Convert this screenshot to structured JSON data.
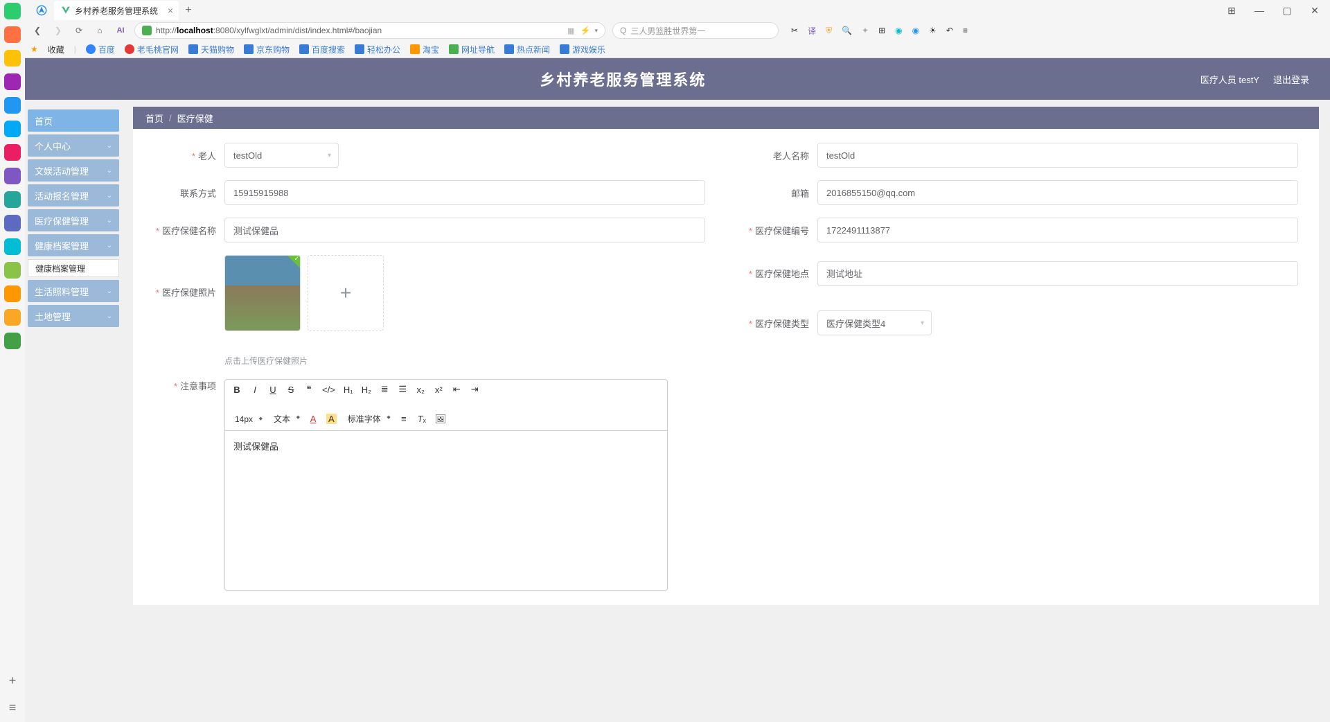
{
  "browser": {
    "tab_title": "乡村养老服务管理系统",
    "url_prefix": "http://",
    "url_host": "localhost",
    "url_rest": ":8080/xylfwglxt/admin/dist/index.html#/baojian",
    "search_placeholder": "三人男篮胜世界第一",
    "favorites_label": "收藏",
    "bookmarks": [
      {
        "label": "百度",
        "color": "#3385ff"
      },
      {
        "label": "老毛桃官网",
        "color": "#e53935"
      },
      {
        "label": "天猫购物",
        "color": "#3a7bd5"
      },
      {
        "label": "京东购物",
        "color": "#3a7bd5"
      },
      {
        "label": "百度搜索",
        "color": "#3a7bd5"
      },
      {
        "label": "轻松办公",
        "color": "#3a7bd5"
      },
      {
        "label": "淘宝",
        "color": "#ff9800"
      },
      {
        "label": "网址导航",
        "color": "#4caf50"
      },
      {
        "label": "热点新闻",
        "color": "#3a7bd5"
      },
      {
        "label": "游戏娱乐",
        "color": "#3a7bd5"
      }
    ]
  },
  "header": {
    "title": "乡村养老服务管理系统",
    "user_label": "医疗人员 testY",
    "logout": "退出登录"
  },
  "sidebar": {
    "items": [
      {
        "label": "首页",
        "type": "home"
      },
      {
        "label": "个人中心",
        "type": "exp"
      },
      {
        "label": "文娱活动管理",
        "type": "exp"
      },
      {
        "label": "活动报名管理",
        "type": "exp"
      },
      {
        "label": "医疗保健管理",
        "type": "exp"
      },
      {
        "label": "健康档案管理",
        "type": "exp"
      },
      {
        "label": "健康档案管理",
        "type": "sub"
      },
      {
        "label": "生活照料管理",
        "type": "exp"
      },
      {
        "label": "土地管理",
        "type": "exp"
      }
    ]
  },
  "breadcrumb": {
    "root": "首页",
    "current": "医疗保健"
  },
  "form": {
    "labels": {
      "elder": "老人",
      "elder_name": "老人名称",
      "contact": "联系方式",
      "email": "邮箱",
      "hc_name": "医疗保健名称",
      "hc_code": "医疗保健编号",
      "hc_photo": "医疗保健照片",
      "hc_place": "医疗保健地点",
      "hc_type": "医疗保健类型",
      "notice": "注意事项"
    },
    "values": {
      "elder": "testOld",
      "elder_name": "testOld",
      "contact": "15915915988",
      "email": "2016855150@qq.com",
      "hc_name": "测试保健品",
      "hc_code": "1722491113877",
      "hc_place": "测试地址",
      "hc_type": "医疗保健类型4"
    },
    "upload_hint": "点击上传医疗保健照片"
  },
  "editor": {
    "font_size": "14px",
    "paragraph": "文本",
    "font_family": "标准字体",
    "content": "测试保健品"
  },
  "os_sidebar_colors": [
    "#2ecc71",
    "#ff7043",
    "#ffc107",
    "#9c27b0",
    "#2196f3",
    "#03a9f4",
    "#e91e63",
    "#7e57c2",
    "#26a69a",
    "#5c6bc0",
    "#00bcd4",
    "#8bc34a",
    "#ff9800",
    "#f9a825",
    "#43a047"
  ]
}
